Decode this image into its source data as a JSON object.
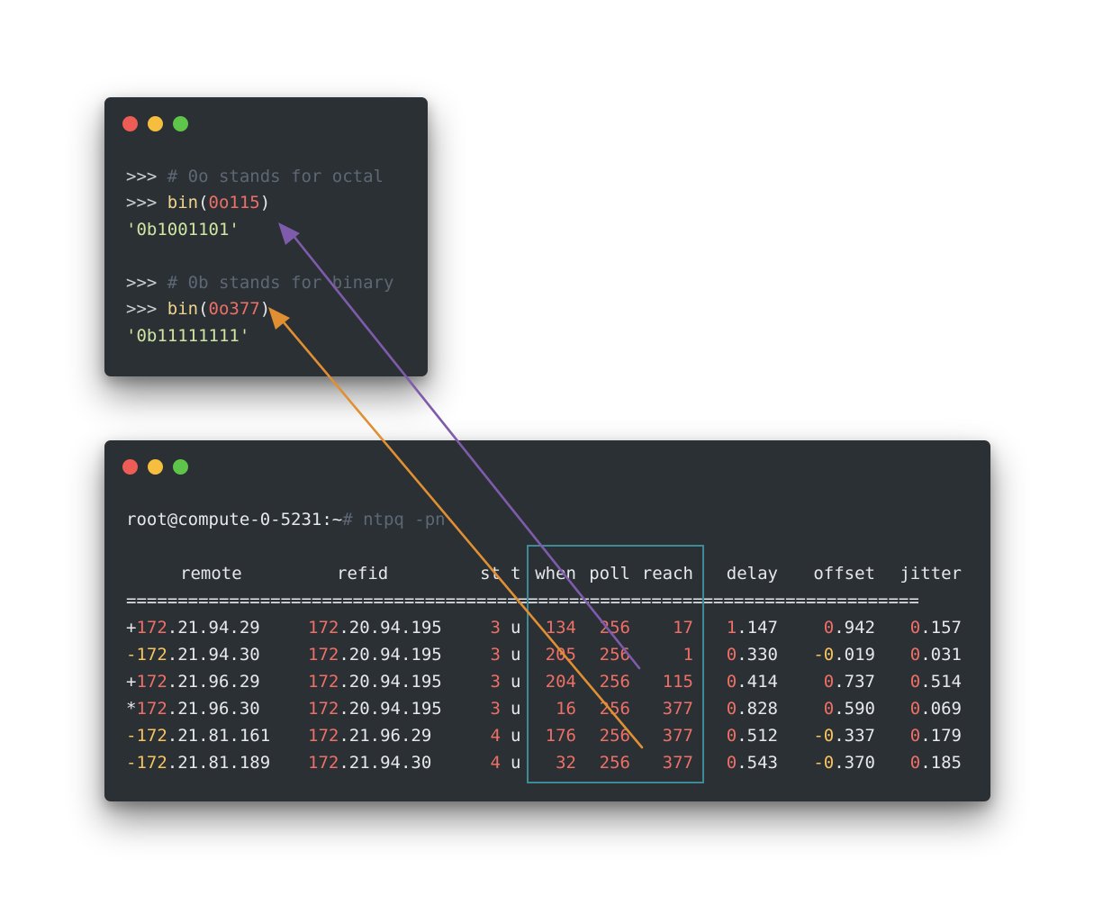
{
  "colors": {
    "terminal_bg": "#2b3035",
    "text": "#e6e8ea",
    "comment": "#5d6874",
    "prompt_chars": "#c9ced3",
    "function": "#f1d58c",
    "number": "#ee6f66",
    "string": "#cfe5a1",
    "yellow_sign": "#f7c35c",
    "highlight_box": "#3f8a98",
    "arrow_purple": "#7e5cab",
    "arrow_orange": "#e08f33",
    "dot_red": "#ee5d55",
    "dot_yellow": "#f6be3f",
    "dot_green": "#5fc44a"
  },
  "python_window": {
    "lines": [
      {
        "prompt": ">>> ",
        "comment": "# 0o stands for octal"
      },
      {
        "prompt": ">>> ",
        "func": "bin",
        "open": "(",
        "arg": "0o115",
        "close": ")"
      },
      {
        "output": "'0b1001101'"
      },
      {
        "prompt": ">>> ",
        "comment": "# 0b stands for binary"
      },
      {
        "prompt": ">>> ",
        "func": "bin",
        "open": "(",
        "arg": "0o377",
        "close": ")"
      },
      {
        "output": "'0b11111111'"
      }
    ]
  },
  "ntpq_window": {
    "prompt": "root@compute-0-5231:~",
    "prompt_sep": "#",
    "command": " ntpq -pn",
    "headers": {
      "remote": "remote",
      "refid": "refid",
      "st": "st",
      "t": "t",
      "when": "when",
      "poll": "poll",
      "reach": "reach",
      "delay": "delay",
      "offset": "offset",
      "jitter": "jitter"
    },
    "separator": "=============================================================================",
    "rows": [
      {
        "tally": "+",
        "remote_a": "172",
        "remote_b": ".21.94.29",
        "refid_a": "172",
        "refid_b": ".20.94.195",
        "st": "3",
        "t": "u",
        "when": "134",
        "poll": "256",
        "reach": "17",
        "delay_a": "1",
        "delay_b": ".147",
        "offset_a": "0",
        "offset_b": ".942",
        "offset_neg": false,
        "jitter_a": "0",
        "jitter_b": ".157"
      },
      {
        "tally": "-",
        "remote_a": "172",
        "remote_b": ".21.94.30",
        "refid_a": "172",
        "refid_b": ".20.94.195",
        "st": "3",
        "t": "u",
        "when": "205",
        "poll": "256",
        "reach": "1",
        "delay_a": "0",
        "delay_b": ".330",
        "offset_a": "-0",
        "offset_b": ".019",
        "offset_neg": true,
        "jitter_a": "0",
        "jitter_b": ".031"
      },
      {
        "tally": "+",
        "remote_a": "172",
        "remote_b": ".21.96.29",
        "refid_a": "172",
        "refid_b": ".20.94.195",
        "st": "3",
        "t": "u",
        "when": "204",
        "poll": "256",
        "reach": "115",
        "delay_a": "0",
        "delay_b": ".414",
        "offset_a": "0",
        "offset_b": ".737",
        "offset_neg": false,
        "jitter_a": "0",
        "jitter_b": ".514"
      },
      {
        "tally": "*",
        "remote_a": "172",
        "remote_b": ".21.96.30",
        "refid_a": "172",
        "refid_b": ".20.94.195",
        "st": "3",
        "t": "u",
        "when": "16",
        "poll": "256",
        "reach": "377",
        "delay_a": "0",
        "delay_b": ".828",
        "offset_a": "0",
        "offset_b": ".590",
        "offset_neg": false,
        "jitter_a": "0",
        "jitter_b": ".069"
      },
      {
        "tally": "-",
        "remote_a": "172",
        "remote_b": ".21.81.161",
        "refid_a": "172",
        "refid_b": ".21.96.29",
        "st": "4",
        "t": "u",
        "when": "176",
        "poll": "256",
        "reach": "377",
        "delay_a": "0",
        "delay_b": ".512",
        "offset_a": "-0",
        "offset_b": ".337",
        "offset_neg": true,
        "jitter_a": "0",
        "jitter_b": ".179"
      },
      {
        "tally": "-",
        "remote_a": "172",
        "remote_b": ".21.81.189",
        "refid_a": "172",
        "refid_b": ".21.94.30",
        "st": "4",
        "t": "u",
        "when": "32",
        "poll": "256",
        "reach": "377",
        "delay_a": "0",
        "delay_b": ".543",
        "offset_a": "-0",
        "offset_b": ".370",
        "offset_neg": true,
        "jitter_a": "0",
        "jitter_b": ".185"
      }
    ]
  }
}
